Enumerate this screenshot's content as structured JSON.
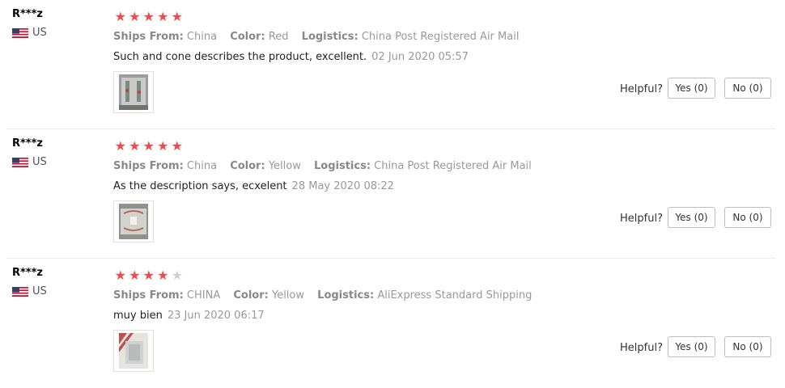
{
  "reviews": [
    {
      "user": "R***z",
      "country": "US",
      "rating": 5,
      "ships_from_label": "Ships From:",
      "ships_from": "China",
      "color_label": "Color:",
      "color": "Red",
      "logistics_label": "Logistics:",
      "logistics": "China Post Registered Air Mail",
      "text": "Such and cone describes the product, excellent.",
      "date": "02 Jun 2020 05:57",
      "helpful_label": "Helpful?",
      "yes_label": "Yes (0)",
      "no_label": "No (0)"
    },
    {
      "user": "R***z",
      "country": "US",
      "rating": 5,
      "ships_from_label": "Ships From:",
      "ships_from": "China",
      "color_label": "Color:",
      "color": "Yellow",
      "logistics_label": "Logistics:",
      "logistics": "China Post Registered Air Mail",
      "text": "As the description says, ecxelent",
      "date": "28 May 2020 08:22",
      "helpful_label": "Helpful?",
      "yes_label": "Yes (0)",
      "no_label": "No (0)"
    },
    {
      "user": "R***z",
      "country": "US",
      "rating": 4,
      "ships_from_label": "Ships From:",
      "ships_from": "CHINA",
      "color_label": "Color:",
      "color": "Yellow",
      "logistics_label": "Logistics:",
      "logistics": "AliExpress Standard Shipping",
      "text": "muy bien",
      "date": "23 Jun 2020 06:17",
      "helpful_label": "Helpful?",
      "yes_label": "Yes (0)",
      "no_label": "No (0)"
    }
  ],
  "icons": {
    "star": "star-icon",
    "flag": "us-flag-icon"
  },
  "colors": {
    "star_on": "#f04b4b",
    "star_off": "#cfcfcf"
  }
}
